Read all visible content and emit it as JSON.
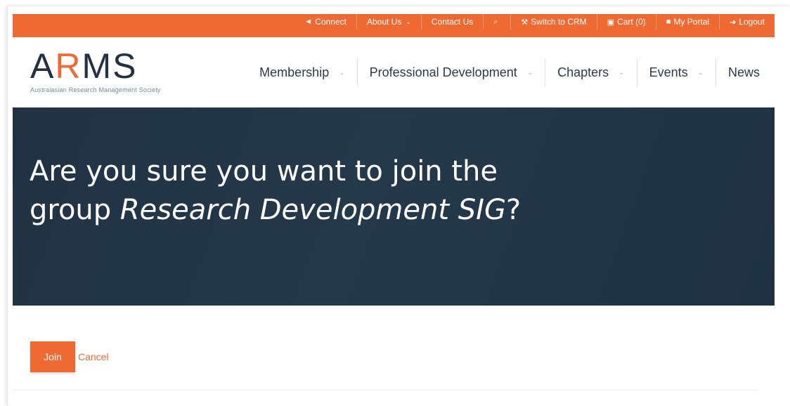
{
  "utility_nav": {
    "connect": "Connect",
    "about_us": "About Us",
    "contact_us": "Contact Us",
    "search_icon": "⌕",
    "switch_crm": "Switch to CRM",
    "cart": "Cart (0)",
    "my_portal": "My Portal",
    "logout": "Logout"
  },
  "logo": {
    "mark_a": "A",
    "mark_r": "R",
    "mark_ms": "MS",
    "tagline": "Australasian Research Management Society"
  },
  "main_nav": {
    "membership": "Membership",
    "professional_development": "Professional Development",
    "chapters": "Chapters",
    "events": "Events",
    "news": "News"
  },
  "hero": {
    "line_prefix": "Are you sure you want to join the group ",
    "group_name": "Research Development SIG",
    "suffix": "?"
  },
  "actions": {
    "join_label": "Join",
    "cancel_label": "Cancel"
  },
  "colors": {
    "accent": "#ef6a32",
    "hero_bg": "#223646",
    "nav_text": "#2c3a4a"
  },
  "icons": {
    "connect": "share-icon",
    "about_chevron": "chevron-down-icon",
    "search": "search-icon",
    "switch_crm": "wrench-icon",
    "cart": "cart-icon",
    "portal": "lock-icon",
    "logout": "logout-icon"
  }
}
